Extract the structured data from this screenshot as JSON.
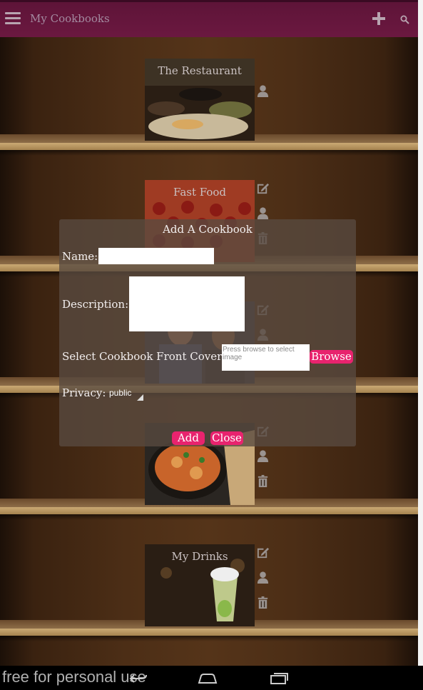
{
  "appbar": {
    "title": "My Cookbooks"
  },
  "books": [
    {
      "label": "The Restaurant"
    },
    {
      "label": "Fast Food"
    },
    {
      "label": ""
    },
    {
      "label": ""
    },
    {
      "label": "My Drinks"
    }
  ],
  "dialog": {
    "title": "Add A Cookbook",
    "name_label": "Name:",
    "name_value": "",
    "description_label": "Description:",
    "description_value": "",
    "cover_label": "Select Cookbook Front Cover :",
    "cover_hint": "Press browse to select image",
    "browse_label": "Browse",
    "privacy_label": "Privacy:",
    "privacy_value": "public",
    "add_label": "Add",
    "close_label": "Close"
  },
  "watermark": "free for personal use",
  "colors": {
    "appbar": "#6b1840",
    "accent": "#e8236e",
    "shelf": "#553419"
  }
}
